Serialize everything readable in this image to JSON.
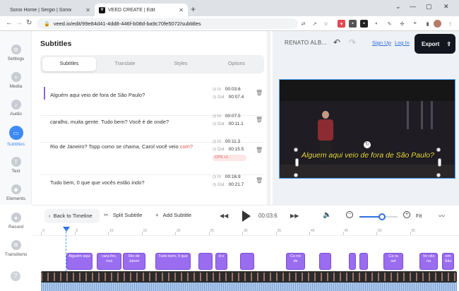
{
  "browser": {
    "tabs": [
      {
        "title": "Sonix Home | Sergio | Sonix",
        "close": "✕"
      },
      {
        "title": "VEED CREATE | Edit",
        "favicon": "V",
        "close": "✕"
      }
    ],
    "new_tab": "+",
    "url": "veed.io/edit/99e84d41-4dd8-446f-b08d-ba9c70fe5072/subtitles",
    "window_controls": [
      "⌄",
      "—",
      "▢",
      "✕"
    ]
  },
  "sidebar": {
    "items": [
      {
        "label": "Settings",
        "icon": "gear-icon"
      },
      {
        "label": "Media",
        "icon": "plus-icon"
      },
      {
        "label": "Audio",
        "icon": "music-icon"
      },
      {
        "label": "Subtitles",
        "icon": "subtitles-icon"
      },
      {
        "label": "Text",
        "icon": "text-icon"
      },
      {
        "label": "Elements",
        "icon": "shapes-icon"
      },
      {
        "label": "Record",
        "icon": "record-icon"
      },
      {
        "label": "Transitions",
        "icon": "transitions-icon"
      }
    ],
    "help": "?"
  },
  "panel": {
    "title": "Subtitles",
    "tabs": [
      "Subtitles",
      "Translate",
      "Styles",
      "Options"
    ],
    "rows": [
      {
        "text": "Alguém aqui veio de fora de São Paulo?",
        "text_warn": "",
        "in_label": "In",
        "in": "00:03.6",
        "out_label": "Out",
        "out": "00:07.4",
        "cps": ""
      },
      {
        "text": "caralho, muita gente. Tudo bem? Você é de onde?",
        "text_warn": "",
        "in_label": "In",
        "in": "00:07.5",
        "out_label": "Out",
        "out": "00:11.1",
        "cps": ""
      },
      {
        "text": "Rio de Janeiro? Topp como se chama, Carol você veio ",
        "text_warn": "com?",
        "in_label": "In",
        "in": "00:11.3",
        "out_label": "Out",
        "out": "00:15.5",
        "cps": "CPS  +1"
      },
      {
        "text": "Tudo bem, 0 que que vocês estão indo?",
        "text_warn": "",
        "in_label": "In",
        "in": "00:16.9",
        "out_label": "Out",
        "out": "00:21.7",
        "cps": ""
      }
    ]
  },
  "header": {
    "project_name": "RENATO ALB...",
    "signup": "Sign Up",
    "separator": "·",
    "login": "Log In",
    "export": "Export"
  },
  "video": {
    "caption": "Alguem aqui veio de fora de São Paulo?"
  },
  "toolbar": {
    "back": "Back to Timeline",
    "split": "Split Subtitle",
    "add": "Add Subtitle",
    "timecode": "00:03:6",
    "fit": "Fit",
    "zoom_level": 0.6
  },
  "timeline": {
    "ticks": [
      "0",
      "5",
      "10",
      "15",
      "20",
      "25",
      "30",
      "35",
      "40",
      "45",
      "50",
      "55"
    ],
    "clips": [
      "Alguém aqui",
      "cara lho, mui",
      "Rio de Janeir",
      "Tudo bem, 0 que",
      "",
      "d e",
      "",
      "",
      "Co rre de",
      "",
      "",
      "",
      "Ca ra set",
      "",
      "Vo cês na",
      "em São"
    ]
  }
}
